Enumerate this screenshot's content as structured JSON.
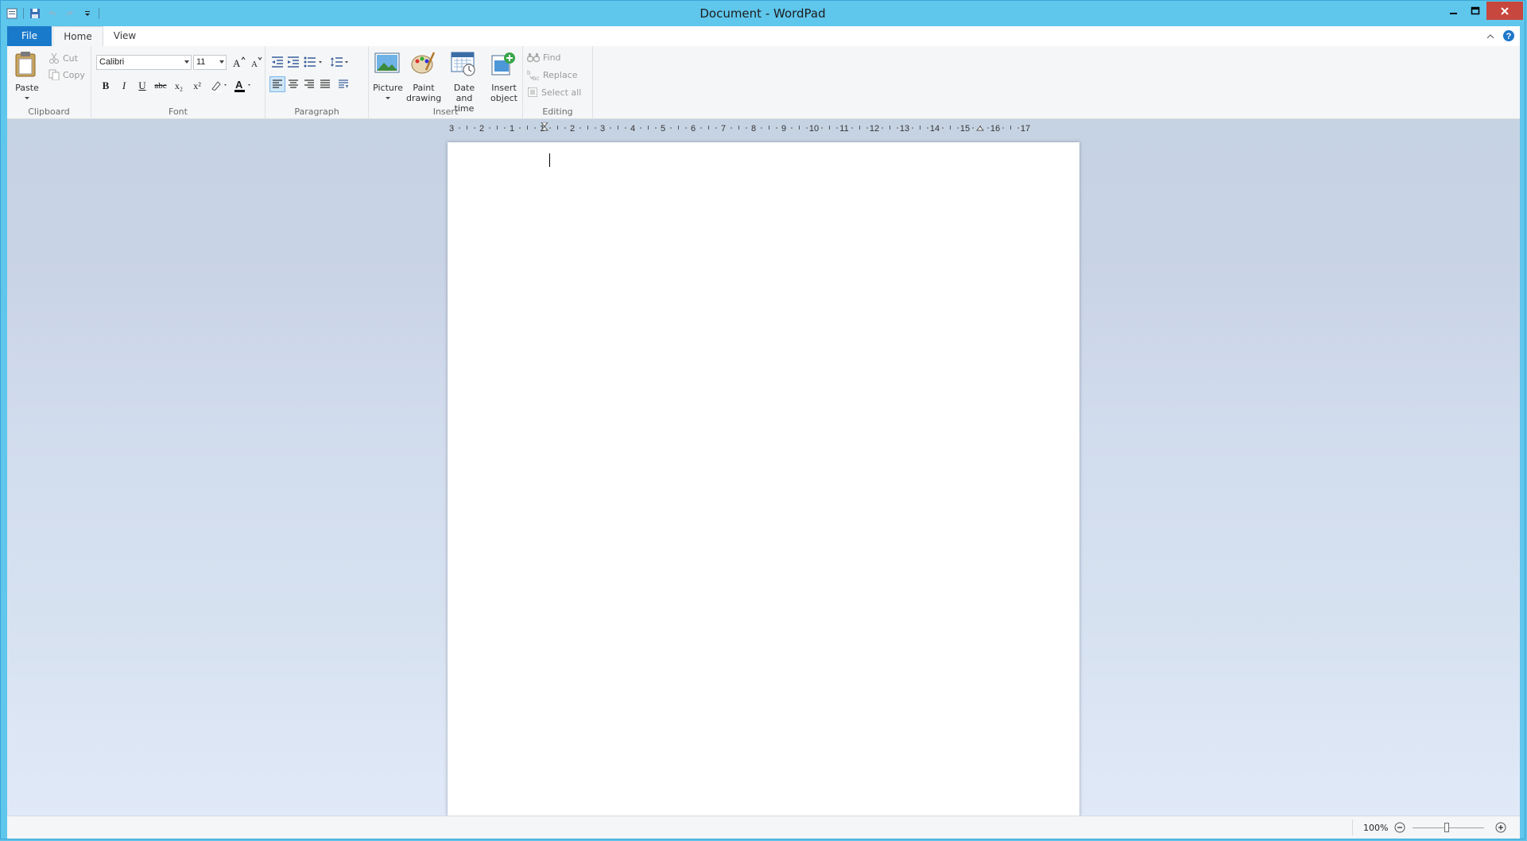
{
  "window": {
    "title": "Document - WordPad",
    "controls": {
      "minimize": "minimize",
      "maximize": "maximize",
      "close": "close"
    }
  },
  "quick_access": [
    {
      "icon": "wordpad-app-icon"
    },
    {
      "icon": "save-icon"
    },
    {
      "icon": "undo-icon"
    },
    {
      "icon": "redo-icon"
    },
    {
      "icon": "customize-dropdown-icon"
    }
  ],
  "tabs": {
    "file": "File",
    "home": "Home",
    "view": "View"
  },
  "ribbon": {
    "clipboard": {
      "label": "Clipboard",
      "paste": "Paste",
      "cut": "Cut",
      "copy": "Copy"
    },
    "font": {
      "label": "Font",
      "family": "Calibri",
      "size": "11"
    },
    "paragraph": {
      "label": "Paragraph"
    },
    "insert": {
      "label": "Insert",
      "picture": "Picture",
      "paint_line1": "Paint",
      "paint_line2": "drawing",
      "datetime_line1": "Date and",
      "datetime_line2": "time",
      "object_line1": "Insert",
      "object_line2": "object"
    },
    "editing": {
      "label": "Editing",
      "find": "Find",
      "replace": "Replace",
      "select_all": "Select all"
    }
  },
  "ruler": {
    "labels": [
      "3",
      "2",
      "1",
      "1",
      "2",
      "3",
      "4",
      "5",
      "6",
      "7",
      "8",
      "9",
      "10",
      "11",
      "12",
      "13",
      "14",
      "15",
      "16",
      "17"
    ]
  },
  "status": {
    "zoom": "100%"
  },
  "colors": {
    "title_bar": "#5fc6ec",
    "file_tab": "#1979ca",
    "close_button": "#c7463d"
  }
}
